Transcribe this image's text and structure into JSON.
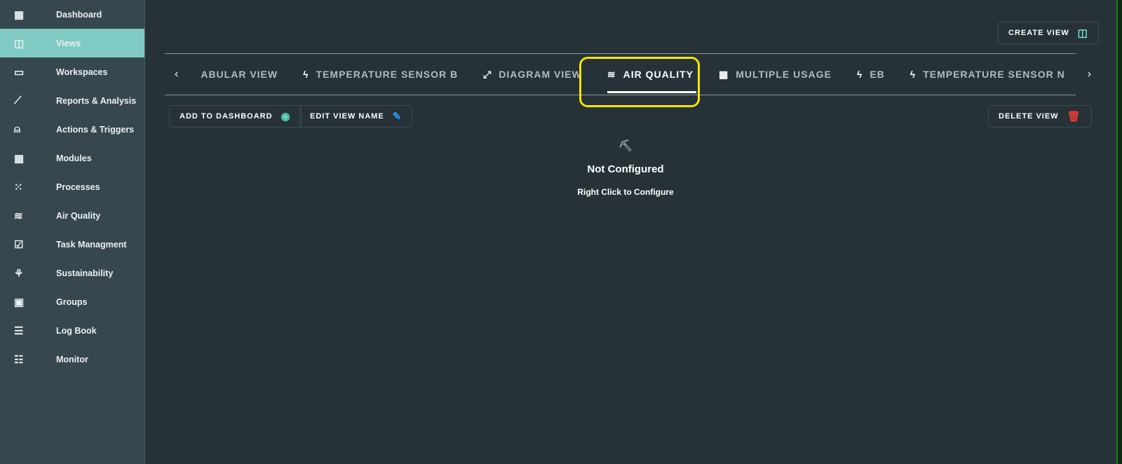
{
  "sidebar": {
    "items": [
      {
        "label": "Dashboard",
        "icon": "dashboard-icon",
        "glyph": "▦"
      },
      {
        "label": "Views",
        "icon": "views-icon",
        "glyph": "◫"
      },
      {
        "label": "Workspaces",
        "icon": "folder-icon",
        "glyph": "▭"
      },
      {
        "label": "Reports & Analysis",
        "icon": "chart-icon",
        "glyph": "⟋"
      },
      {
        "label": "Actions & Triggers",
        "icon": "alarm-icon",
        "glyph": "⍝"
      },
      {
        "label": "Modules",
        "icon": "grid-icon",
        "glyph": "▦"
      },
      {
        "label": "Processes",
        "icon": "dots-grid-icon",
        "glyph": "⁙"
      },
      {
        "label": "Air Quality",
        "icon": "air-icon",
        "glyph": "≋"
      },
      {
        "label": "Task Managment",
        "icon": "calendar-check-icon",
        "glyph": "☑"
      },
      {
        "label": "Sustainability",
        "icon": "plant-icon",
        "glyph": "⚘"
      },
      {
        "label": "Groups",
        "icon": "group-icon",
        "glyph": "▣"
      },
      {
        "label": "Log Book",
        "icon": "book-icon",
        "glyph": "☰"
      },
      {
        "label": "Monitor",
        "icon": "monitor-icon",
        "glyph": "☷"
      }
    ],
    "active": "Views"
  },
  "toolbar": {
    "create_view": "CREATE VIEW",
    "add_to_dashboard": "ADD TO DASHBOARD",
    "edit_view_name": "EDIT VIEW NAME",
    "delete_view": "DELETE VIEW"
  },
  "tabs": [
    {
      "label": "ABULAR VIEW",
      "glyph": ""
    },
    {
      "label": "TEMPERATURE SENSOR B",
      "glyph": "ϟ"
    },
    {
      "label": "DIAGRAM VIEW",
      "glyph": "⤢"
    },
    {
      "label": "AIR QUALITY",
      "glyph": "≋"
    },
    {
      "label": "MULTIPLE USAGE",
      "glyph": "▦"
    },
    {
      "label": "EB",
      "glyph": "ϟ"
    },
    {
      "label": "TEMPERATURE SENSOR N",
      "glyph": "ϟ"
    }
  ],
  "active_tab": "AIR QUALITY",
  "empty": {
    "title": "Not Configured",
    "subtitle": "Right Click to Configure"
  },
  "colors": {
    "accent": "#7fcac3",
    "delete": "#e53935",
    "edit": "#2196f3",
    "highlight": "#f2e600"
  }
}
